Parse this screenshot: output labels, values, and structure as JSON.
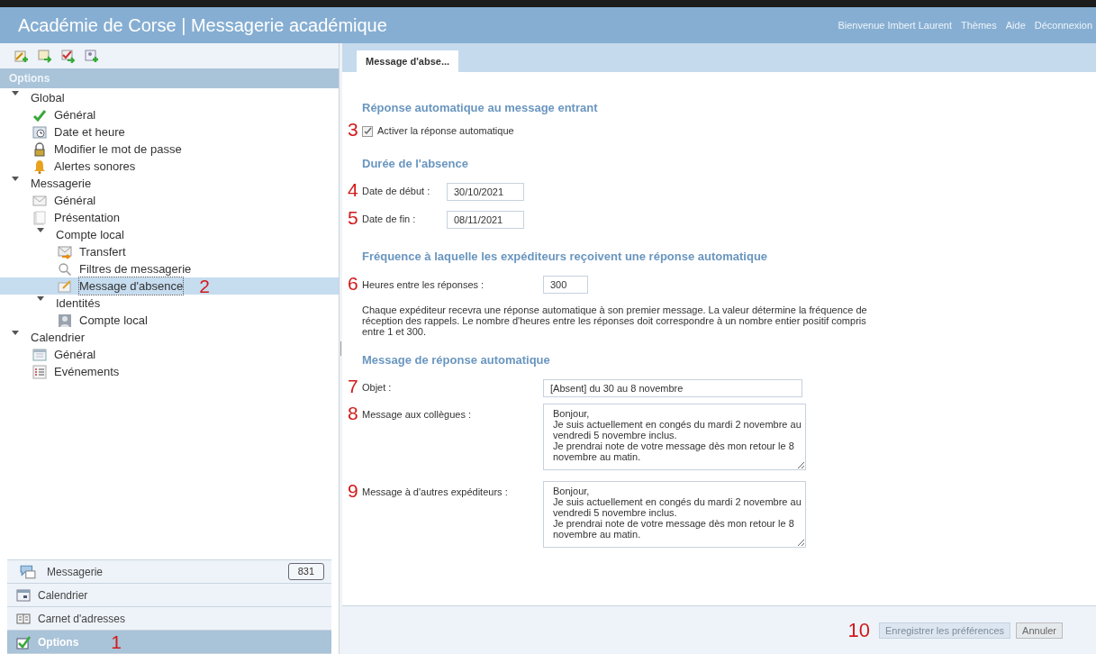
{
  "header": {
    "title": "Académie de Corse | Messagerie académique",
    "links": [
      "Bienvenue Imbert Laurent",
      "Thèmes",
      "Aide",
      "Déconnexion"
    ]
  },
  "sidebar": {
    "heading": "Options",
    "tree": [
      {
        "label": "Global",
        "expanded": true,
        "children": [
          {
            "label": "Général",
            "selected": false
          },
          {
            "label": "Date et heure",
            "selected": false
          },
          {
            "label": "Modifier le mot de passe",
            "selected": false
          },
          {
            "label": "Alertes sonores",
            "selected": false
          }
        ]
      },
      {
        "label": "Messagerie",
        "expanded": true,
        "children": [
          {
            "label": "Général",
            "selected": false
          },
          {
            "label": "Présentation",
            "selected": false
          },
          {
            "label": "Compte local",
            "expanded": true,
            "children": [
              {
                "label": "Transfert",
                "selected": false
              },
              {
                "label": "Filtres de messagerie",
                "selected": false
              },
              {
                "label": "Message d'absence",
                "selected": true,
                "callout": "2"
              }
            ]
          },
          {
            "label": "Identités",
            "expanded": true,
            "children": [
              {
                "label": "Compte local",
                "selected": false
              }
            ]
          }
        ]
      },
      {
        "label": "Calendrier",
        "expanded": true,
        "children": [
          {
            "label": "Général",
            "selected": false
          },
          {
            "label": "Evénements",
            "selected": false
          }
        ]
      }
    ],
    "nav": [
      {
        "label": "Messagerie",
        "count": "831",
        "selected": false
      },
      {
        "label": "Calendrier",
        "selected": false
      },
      {
        "label": "Carnet d'adresses",
        "selected": false
      },
      {
        "label": "Options",
        "selected": true,
        "callout": "1"
      }
    ]
  },
  "tabs": [
    {
      "label": "Message d'abse...",
      "selected": true
    }
  ],
  "form": {
    "sections": [
      {
        "heading": "Réponse automatique au message entrant",
        "fields": [
          {
            "kind": "checkbox",
            "label": "Activer la réponse automatique",
            "checked": true,
            "callout": "3"
          }
        ]
      },
      {
        "heading": "Durée de l'absence",
        "fields": [
          {
            "kind": "date",
            "label": "Date de début :",
            "value": "30/10/2021",
            "callout": "4"
          },
          {
            "kind": "date",
            "label": "Date de fin :",
            "value": "08/11/2021",
            "callout": "5"
          }
        ]
      },
      {
        "heading": "Fréquence à laquelle les expéditeurs reçoivent une réponse automatique",
        "fields": [
          {
            "kind": "number",
            "label": "Heures entre les réponses :",
            "value": "300",
            "callout": "6"
          },
          {
            "kind": "note",
            "text": "Chaque expéditeur recevra une réponse automatique à son premier message. La valeur détermine la fréquence de réception des rappels. Le nombre d'heures entre les réponses doit correspondre à un nombre entier positif compris entre 1 et 300."
          }
        ]
      },
      {
        "heading": "Message de réponse automatique",
        "fields": [
          {
            "kind": "text",
            "label": "Objet :",
            "value": "[Absent] du 30 au 8 novembre",
            "callout": "7"
          },
          {
            "kind": "textarea",
            "label": "Message aux collègues :",
            "value": "Bonjour,\nJe suis actuellement en congés du mardi 2 novembre au vendredi 5 novembre inclus.\nJe prendrai note de votre message dès mon retour le 8 novembre au matin.",
            "callout": "8"
          },
          {
            "kind": "textarea",
            "label": "Message à d'autres expéditeurs :",
            "value": "Bonjour,\nJe suis actuellement en congés du mardi 2 novembre au vendredi 5 novembre inclus.\nJe prendrai note de votre message dès mon retour le 8 novembre au matin.",
            "callout": "9"
          }
        ]
      }
    ]
  },
  "footer": {
    "callout": "10",
    "buttons": [
      {
        "label": "Enregistrer les préférences",
        "disabled": true
      },
      {
        "label": "Annuler",
        "disabled": false
      }
    ]
  }
}
